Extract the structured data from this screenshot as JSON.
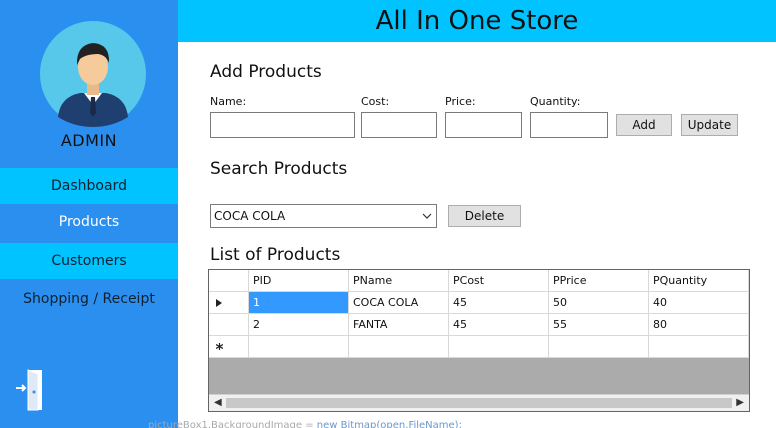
{
  "app": {
    "title": "All In One Store"
  },
  "sidebar": {
    "user_label": "ADMIN",
    "items": [
      {
        "label": "Dashboard"
      },
      {
        "label": "Products"
      },
      {
        "label": "Customers"
      },
      {
        "label": "Shopping / Receipt"
      }
    ]
  },
  "add_products": {
    "heading": "Add Products",
    "fields": {
      "name": {
        "label": "Name:",
        "value": ""
      },
      "cost": {
        "label": "Cost:",
        "value": ""
      },
      "price": {
        "label": "Price:",
        "value": ""
      },
      "quantity": {
        "label": "Quantity:",
        "value": ""
      }
    },
    "add_label": "Add",
    "update_label": "Update"
  },
  "search_products": {
    "heading": "Search Products",
    "selected": "COCA COLA",
    "delete_label": "Delete"
  },
  "product_list": {
    "heading": "List of Products",
    "columns": [
      "PID",
      "PName",
      "PCost",
      "PPrice",
      "PQuantity"
    ],
    "rows": [
      [
        "1",
        "COCA COLA",
        "45",
        "50",
        "40"
      ],
      [
        "2",
        "FANTA",
        "45",
        "55",
        "80"
      ]
    ]
  },
  "background_caption": {
    "a": "pictureBox1.BackgroundImage = ",
    "b": "new Bitmap(open.FileName);"
  },
  "colors": {
    "sidebar": "#2b8ff0",
    "accent": "#00c3ff",
    "selection": "#3399ff"
  }
}
